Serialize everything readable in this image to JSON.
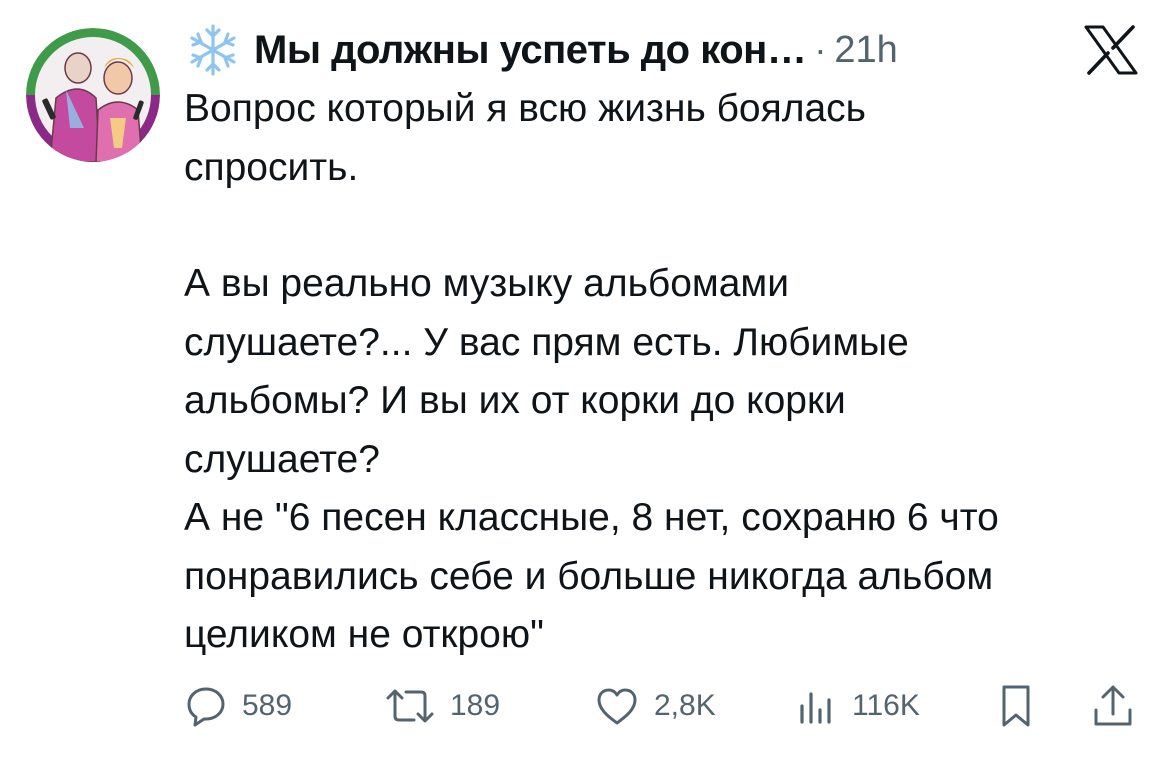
{
  "tweet": {
    "author_name": "Мы должны успеть до кон…",
    "separator": "·",
    "time": "21h",
    "paragraphs": [
      "Вопрос который я всю жизнь боялась\nспросить.",
      "А вы реально музыку альбомами\nслушаете?... У вас прям есть. Любимые\nальбомы? И вы их от корки до корки\nслушаете?\nА не \"6 песен классные, 8 нет, сохраню 6 что\nпонравились себе и больше никогда альбом\nцеликом не открою\""
    ]
  },
  "icons": {
    "author_badge": "snowflake-icon",
    "platform_logo": "x-logo-icon",
    "reply": "speech-bubble-icon",
    "retweet": "retweet-arrows-icon",
    "like": "heart-icon",
    "views": "bar-chart-icon",
    "bookmark": "bookmark-icon",
    "share": "share-upload-icon"
  },
  "actions": {
    "replies": "589",
    "retweets": "189",
    "likes": "2,8K",
    "views": "116K"
  },
  "colors": {
    "text": "#0f1419",
    "muted": "#536471",
    "snowflake": "#8ec5ee",
    "avatar_ring_green": "#3f9a4a",
    "avatar_ring_purple": "#8a2a86"
  }
}
